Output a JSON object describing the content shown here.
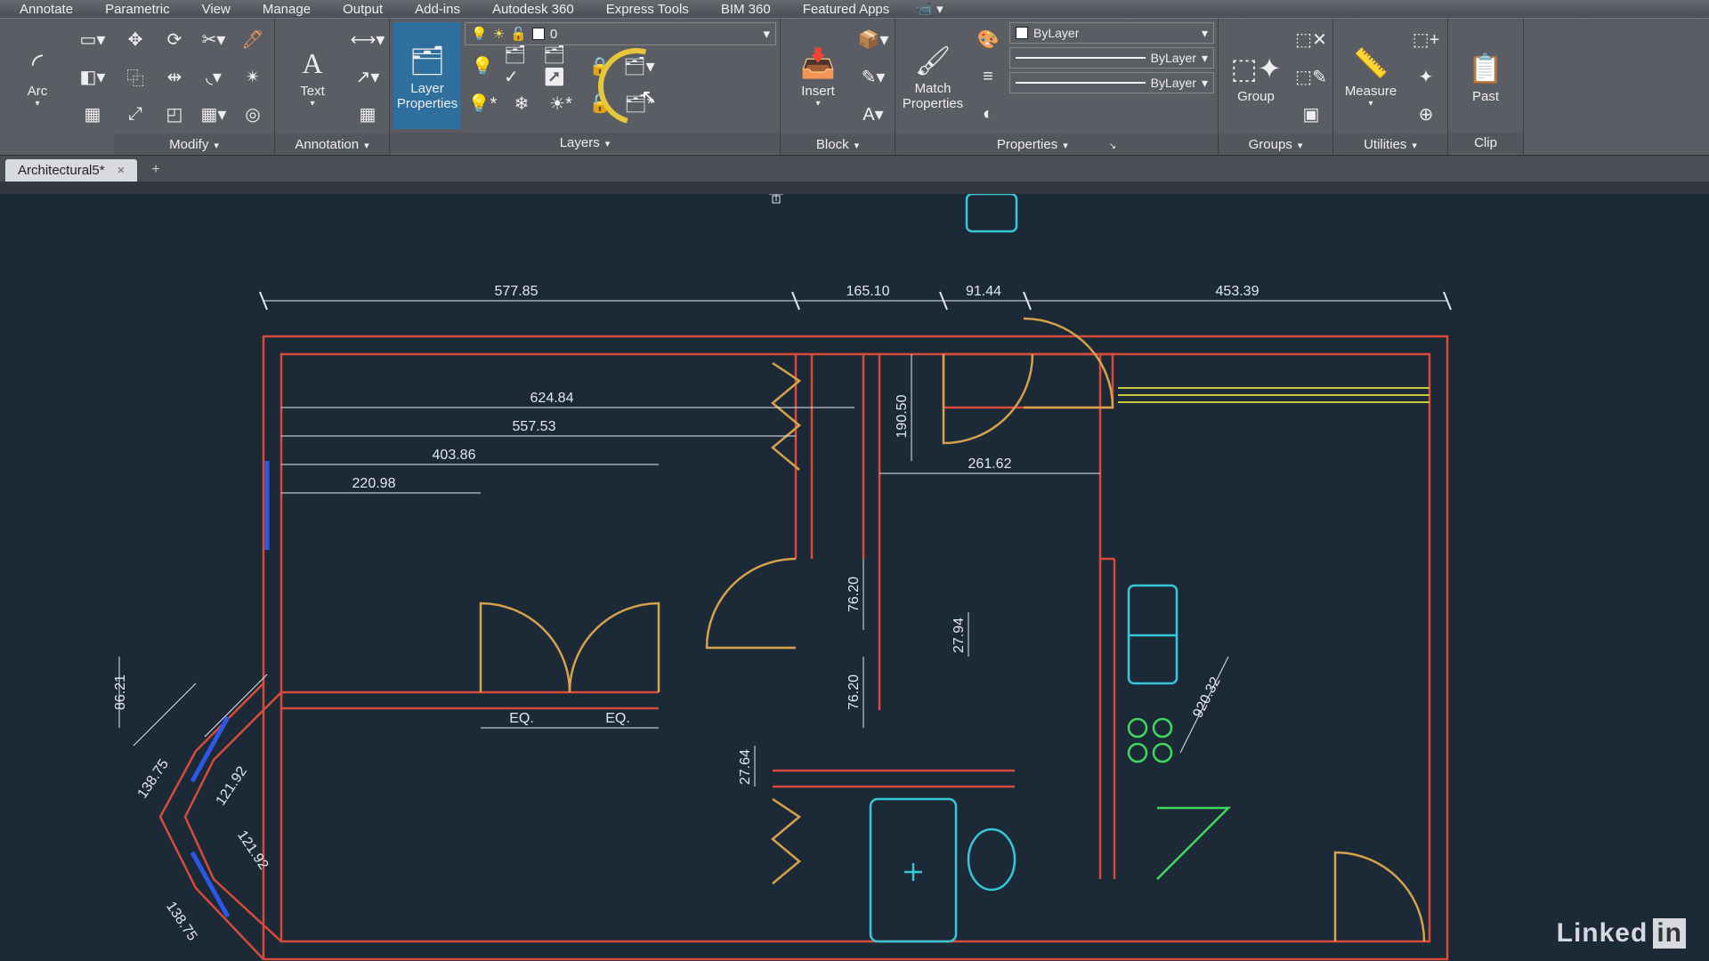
{
  "menu": [
    "Annotate",
    "Parametric",
    "View",
    "Manage",
    "Output",
    "Add-ins",
    "Autodesk 360",
    "Express Tools",
    "BIM 360",
    "Featured Apps"
  ],
  "ribbon": {
    "draw": {
      "main_label": "Arc"
    },
    "modify": {
      "title": "Modify"
    },
    "annotation": {
      "main_label": "Text",
      "title": "Annotation"
    },
    "layers": {
      "main_label": "Layer\nProperties",
      "title": "Layers",
      "current": "0"
    },
    "block": {
      "main_label": "Insert",
      "title": "Block"
    },
    "properties": {
      "main_label": "Match\nProperties",
      "title": "Properties",
      "color": "ByLayer",
      "lineweight": "ByLayer",
      "linetype": "ByLayer"
    },
    "groups": {
      "main_label": "Group",
      "title": "Groups"
    },
    "utilities": {
      "main_label": "Measure",
      "title": "Utilities"
    },
    "clipboard": {
      "main_label": "Past",
      "title": "Clip"
    }
  },
  "file_tab": {
    "name": "Architectural5*",
    "close": "×",
    "new": "+"
  },
  "dimensions": {
    "top": {
      "a": "577.85",
      "b": "165.10",
      "c": "91.44",
      "d": "453.39"
    },
    "left_stack": {
      "a": "624.84",
      "b": "557.53",
      "c": "403.86",
      "d": "220.98"
    },
    "right_mid": "261.62",
    "v_mid_a": "190.50",
    "v_mid_b": "76.20",
    "v_mid_c": "27.94",
    "v_mid_d": "76.20",
    "v_mid_e": "27.64",
    "diag": "920.32",
    "eq": "EQ.",
    "leftside": {
      "a": "86.21",
      "b": "138.75",
      "c": "121.92",
      "d": "121.92",
      "e": "138.75"
    }
  },
  "watermark": {
    "brand": "Linked",
    "suffix": "in"
  }
}
